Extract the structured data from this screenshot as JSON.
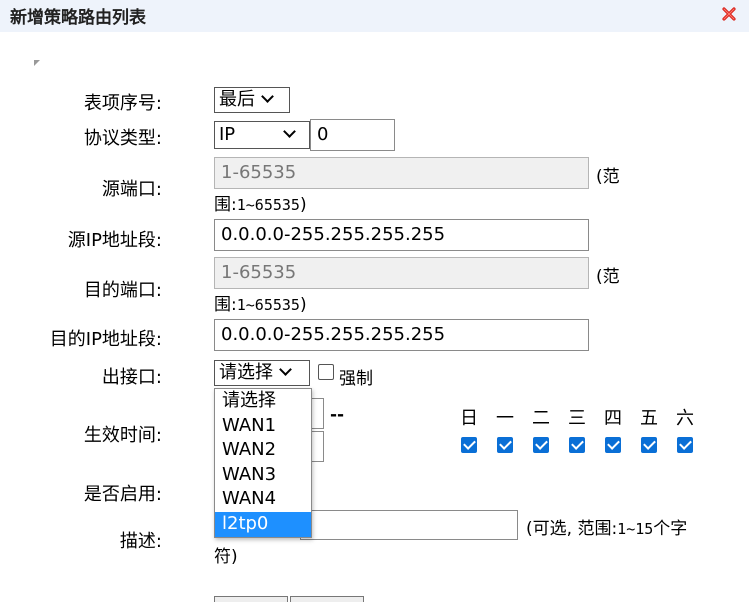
{
  "dialog": {
    "title": "新增策略路由列表",
    "close_icon": "close-icon",
    "close_color": "#d9231c"
  },
  "form": {
    "index": {
      "label": "表项序号:",
      "value": "最后"
    },
    "protocol": {
      "label": "协议类型:",
      "value": "IP",
      "number": "0"
    },
    "src_port": {
      "label": "源端口:",
      "placeholder": "1-65535",
      "note_prefix": "(范",
      "note_suffix": "围:",
      "note_range": "1~65535",
      "note_end": ")"
    },
    "src_ip": {
      "label": "源IP地址段:",
      "value": "0.0.0.0-255.255.255.255"
    },
    "dst_port": {
      "label": "目的端口:",
      "placeholder": "1-65535",
      "note_prefix": "(范",
      "note_suffix": "围:",
      "note_range": "1~65535",
      "note_end": ")"
    },
    "dst_ip": {
      "label": "目的IP地址段:",
      "value": "0.0.0.0-255.255.255.255"
    },
    "iface": {
      "label": "出接口:",
      "value": "请选择",
      "force_label": "强制",
      "options": [
        "请选择",
        "WAN1",
        "WAN2",
        "WAN3",
        "WAN4",
        "l2tp0"
      ],
      "highlighted": "l2tp0"
    },
    "time": {
      "label": "生效时间:",
      "separator": "--",
      "days": [
        "日",
        "一",
        "二",
        "三",
        "四",
        "五",
        "六"
      ],
      "days_checked": [
        true,
        true,
        true,
        true,
        true,
        true,
        true
      ]
    },
    "enable": {
      "label": "是否启用:"
    },
    "desc": {
      "label": "描述:",
      "note_line1_a": "(可选, 范围:",
      "note_line1_b": "1~15",
      "note_line1_c": "个字",
      "note_line2": "符)"
    }
  },
  "colors": {
    "titlebar_bg": "#eef3fb",
    "accent": "#0a6fd6",
    "highlight": "#1e90ff"
  }
}
